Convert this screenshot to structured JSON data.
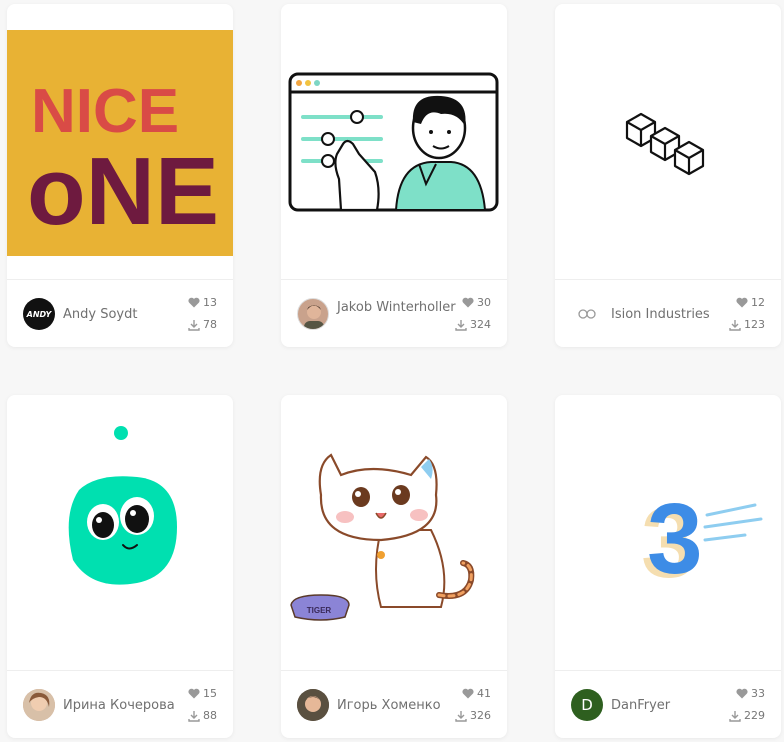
{
  "cards": [
    {
      "title_art": {
        "line1": "NICE",
        "line2": "oNE"
      },
      "author": "Andy Soydt",
      "avatar_text": "ANDY",
      "likes": "13",
      "downloads": "78"
    },
    {
      "author": "Jakob Winterholler",
      "likes": "30",
      "downloads": "324"
    },
    {
      "author": "Ision Industries",
      "likes": "12",
      "downloads": "123"
    },
    {
      "author": "Ирина Кочерова",
      "likes": "15",
      "downloads": "88"
    },
    {
      "bowl_label": "TIGER",
      "author": "Игорь Хоменко",
      "likes": "41",
      "downloads": "326"
    },
    {
      "art_number": "3",
      "author": "DanFryer",
      "avatar_text": "D",
      "likes": "33",
      "downloads": "229"
    }
  ],
  "colors": {
    "page_bg": "#f7f7f7",
    "mint": "#00e0b0",
    "orange": "#e8b234",
    "maroon": "#6e1a3f",
    "red": "#d94b46",
    "blue": "#3d8ce6",
    "green_avatar": "#2e5f1f"
  },
  "icons": {
    "like": "heart-icon",
    "download": "download-icon"
  }
}
